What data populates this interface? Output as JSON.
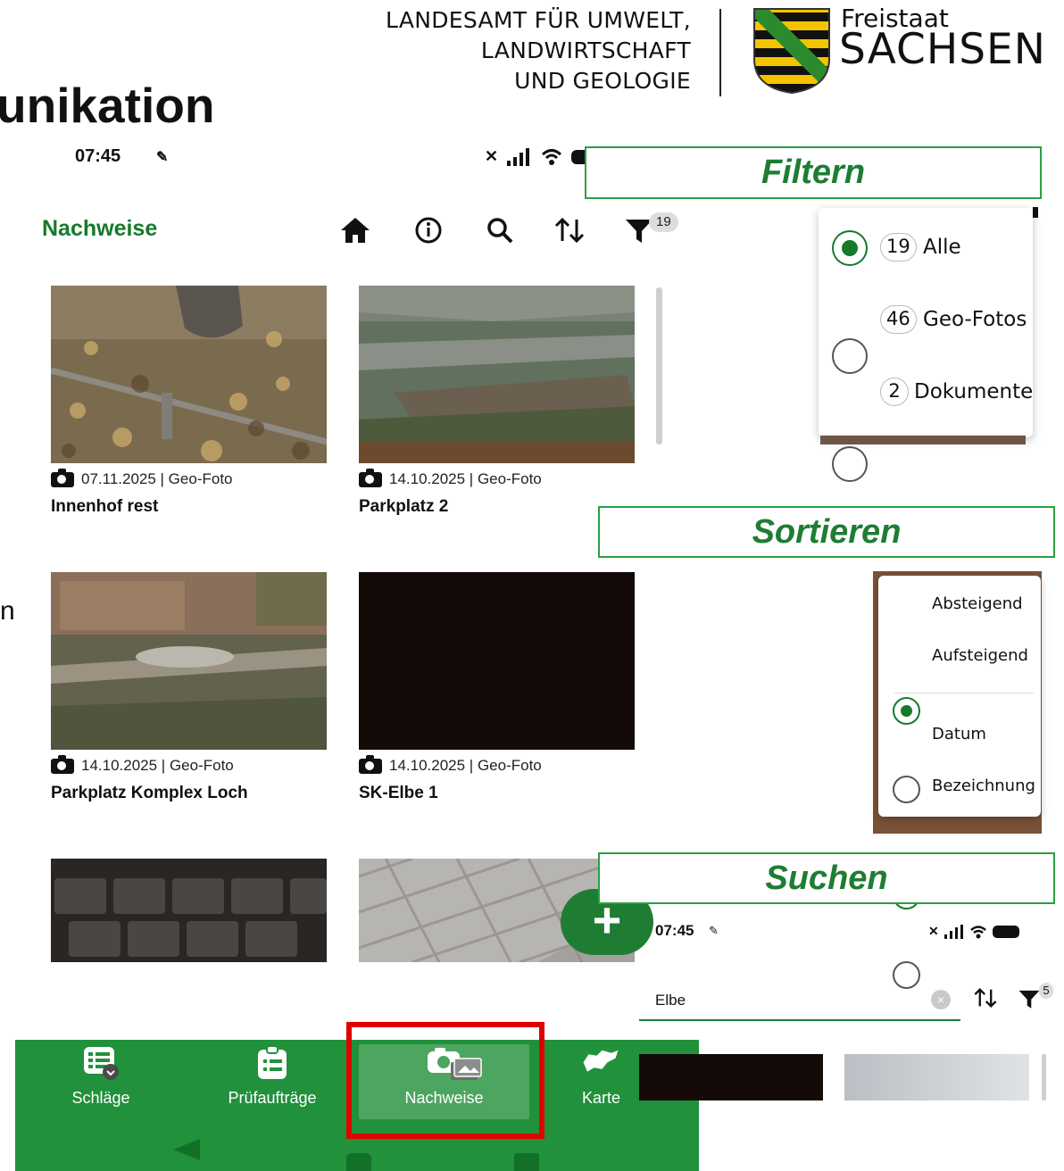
{
  "slide": {
    "org_lines": [
      "LANDESAMT FÜR UMWELT,",
      "LANDWIRTSCHAFT",
      "UND GEOLOGIE"
    ],
    "brand_small": "Freistaat",
    "brand_large": "SACHSEN",
    "title_fragment": "unikation",
    "left_cut_text": "n"
  },
  "status_bar": {
    "time": "07:45"
  },
  "app": {
    "title": "Nachweise",
    "header_icons": [
      "home-icon",
      "info-icon",
      "search-icon",
      "sort-icon",
      "filter-icon"
    ],
    "filter_badge": "19"
  },
  "items": [
    {
      "meta": "07.11.2025 | Geo-Foto",
      "title": "Innenhof rest"
    },
    {
      "meta": "14.10.2025 | Geo-Foto",
      "title": "Parkplatz 2"
    },
    {
      "meta": "14.10.2025 | Geo-Foto",
      "title": "Parkplatz Komplex Loch"
    },
    {
      "meta": "14.10.2025 | Geo-Foto",
      "title": "SK-Elbe 1"
    }
  ],
  "fab": {
    "icon": "plus-icon"
  },
  "bottom_nav": [
    {
      "label": "Schläge",
      "icon": "list-icon"
    },
    {
      "label": "Prüfaufträge",
      "icon": "clipboard-icon"
    },
    {
      "label": "Nachweise",
      "icon": "camera-gallery-icon",
      "active": true
    },
    {
      "label": "Karte",
      "icon": "map-icon"
    }
  ],
  "callouts": {
    "filter": "Filtern",
    "sort": "Sortieren",
    "search": "Suchen"
  },
  "filter_popup": {
    "options": [
      {
        "count": "19",
        "label": "Alle",
        "selected": true
      },
      {
        "count": "46",
        "label": "Geo-Fotos",
        "selected": false
      },
      {
        "count": "2",
        "label": "Dokumente",
        "selected": false
      }
    ]
  },
  "sort_popup": {
    "order": [
      {
        "label": "Absteigend",
        "selected": true
      },
      {
        "label": "Aufsteigend",
        "selected": false
      }
    ],
    "field": [
      {
        "label": "Datum",
        "selected": true
      },
      {
        "label": "Bezeichnung",
        "selected": false
      }
    ]
  },
  "search_screen": {
    "time": "07:45",
    "query": "Elbe",
    "filter_badge": "5"
  },
  "colors": {
    "brand_green": "#21913b",
    "dark_green": "#167a2b",
    "highlight_red": "#e00000"
  }
}
